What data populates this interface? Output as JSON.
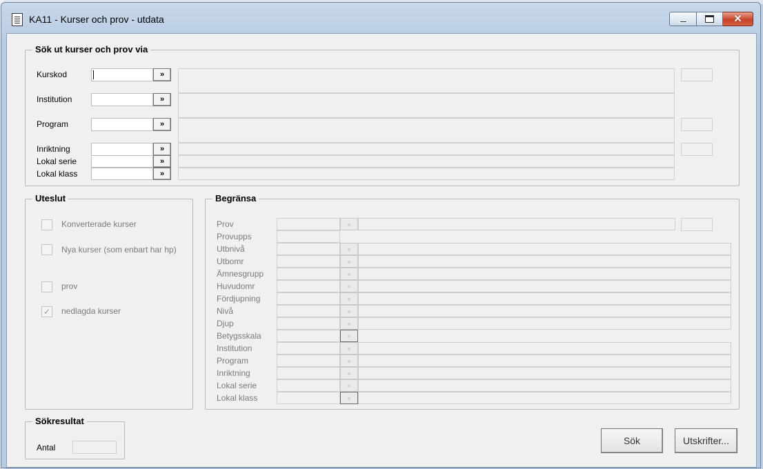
{
  "window": {
    "title": "KA11 - Kurser och prov - utdata"
  },
  "search_via": {
    "title": "Sök ut kurser och prov via",
    "rows": [
      {
        "label": "Kurskod",
        "value": ""
      },
      {
        "label": "Institution",
        "value": ""
      },
      {
        "label": "Program",
        "value": ""
      },
      {
        "label": "Inriktning",
        "value": ""
      },
      {
        "label": "Lokal serie",
        "value": ""
      },
      {
        "label": "Lokal klass",
        "value": ""
      }
    ],
    "lookup_glyph": "»"
  },
  "exclude": {
    "title": "Uteslut",
    "options": [
      {
        "label": "Konverterade kurser",
        "checked": false,
        "mark": ""
      },
      {
        "label": "Nya kurser (som enbart har hp)",
        "checked": false,
        "mark": ""
      },
      {
        "label": "prov",
        "checked": false,
        "mark": ""
      },
      {
        "label": "nedlagda kurser",
        "checked": true,
        "mark": "✓"
      }
    ]
  },
  "limit": {
    "title": "Begränsa",
    "rows": [
      {
        "label": "Prov"
      },
      {
        "label": "Provupps"
      },
      {
        "label": "Utbnivå"
      },
      {
        "label": "Utbomr"
      },
      {
        "label": "Ämnesgrupp"
      },
      {
        "label": "Huvudomr"
      },
      {
        "label": "Fördjupning"
      },
      {
        "label": "Nivå"
      },
      {
        "label": "Djup"
      },
      {
        "label": "Betygsskala"
      },
      {
        "label": "Institution"
      },
      {
        "label": "Program"
      },
      {
        "label": "Inriktning"
      },
      {
        "label": "Lokal serie"
      },
      {
        "label": "Lokal klass"
      }
    ],
    "lookup_glyph": "»"
  },
  "result": {
    "title": "Sökresultat",
    "count_label": "Antal",
    "count_value": ""
  },
  "buttons": {
    "search": "Sök",
    "prints": "Utskrifter..."
  }
}
